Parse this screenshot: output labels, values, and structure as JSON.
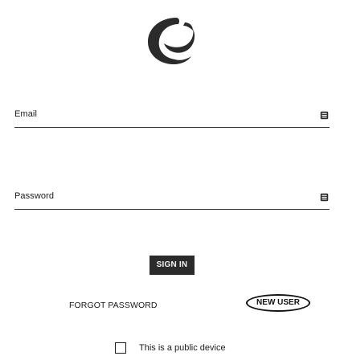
{
  "logo": {
    "icon": "circular-c-check-logo",
    "color": "#2b2b2b"
  },
  "email": {
    "label": "Email",
    "value": "",
    "icon": "contact-card-icon"
  },
  "password": {
    "label": "Password",
    "value": "",
    "icon": "contact-card-icon"
  },
  "actions": {
    "signin_label": "SIGN IN",
    "forgot_label": "FORGOT PASSWORD",
    "new_user_label": "NEW USER"
  },
  "public_device": {
    "label": "This is a public device",
    "checked": false
  },
  "colors": {
    "primary": "#2b2b2b",
    "text": "#1a1a1a",
    "background": "#ffffff"
  }
}
